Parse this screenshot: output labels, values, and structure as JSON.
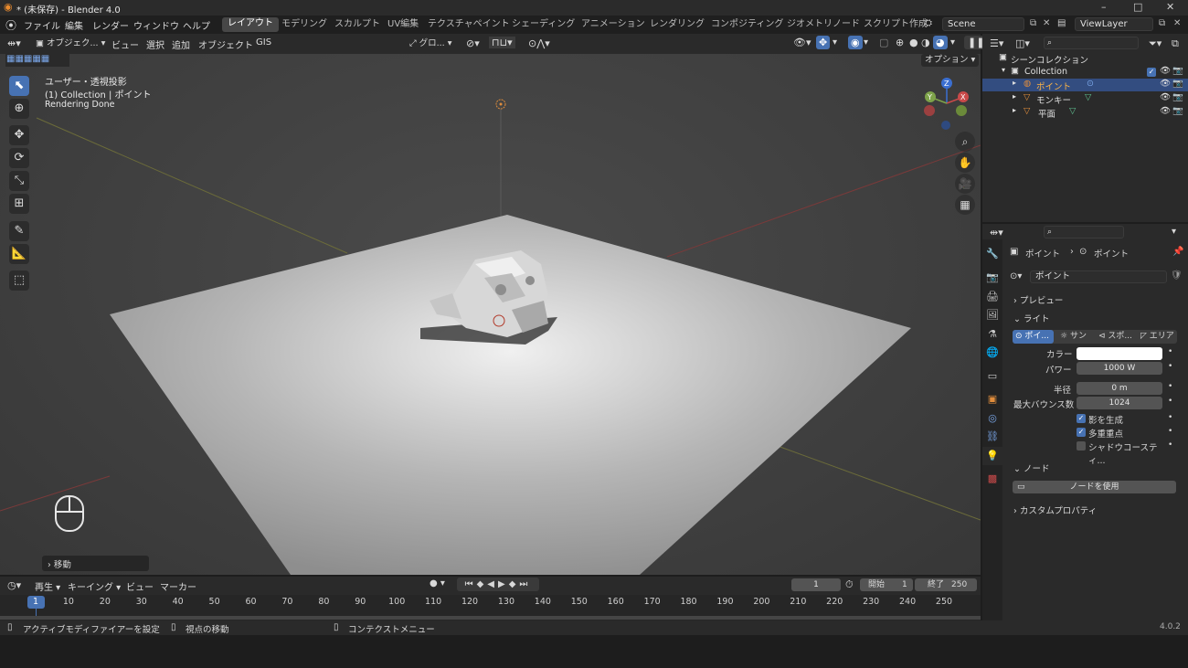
{
  "window": {
    "title": "* (未保存) - Blender 4.0",
    "minimize": "–",
    "maximize": "□",
    "close": "✕"
  },
  "menu": [
    "ファイル",
    "編集",
    "レンダー",
    "ウィンドウ",
    "ヘルプ"
  ],
  "workspaces": [
    "レイアウト",
    "モデリング",
    "スカルプト",
    "UV編集",
    "テクスチャペイント",
    "シェーディング",
    "アニメーション",
    "レンダリング",
    "コンポジティング",
    "ジオメトリノード",
    "スクリプト作成"
  ],
  "scene": {
    "name": "Scene",
    "view_layer": "ViewLayer"
  },
  "viewport_header": {
    "mode": "オブジェク...",
    "menus": [
      "ビュー",
      "選択",
      "追加",
      "オブジェクト",
      "GIS"
    ],
    "transform": "グロ...",
    "options": "オプション"
  },
  "viewport_info": {
    "line1": "ユーザー・透視投影",
    "line2": "(1) Collection | ポイント",
    "line3": "Rendering Done"
  },
  "gizmo": {
    "x": "X",
    "y": "Y",
    "z": "Z"
  },
  "operator_panel": "移動",
  "outliner": {
    "root": "シーンコレクション",
    "collection": "Collection",
    "items": [
      "ポイント",
      "モンキー",
      "平面"
    ]
  },
  "properties": {
    "breadcrumb1": "ポイント",
    "breadcrumb2": "ポイント",
    "data_name": "ポイント",
    "preview": "プレビュー",
    "light_section": "ライト",
    "light_types": [
      "ポイ...",
      "サン",
      "スポ...",
      "エリア"
    ],
    "color_label": "カラー",
    "power_label": "パワー",
    "power_value": "1000 W",
    "radius_label": "半径",
    "radius_value": "0 m",
    "bounces_label": "最大バウンス数",
    "bounces_value": "1024",
    "cast_shadow": "影を生成",
    "multi_importance": "多重重点",
    "shadow_caustics": "シャドウコースティ...",
    "nodes_section": "ノード",
    "use_nodes": "ノードを使用",
    "custom_props": "カスタムプロパティ"
  },
  "timeline": {
    "menus": [
      "再生",
      "キーイング",
      "ビュー",
      "マーカー"
    ],
    "current_frame": "1",
    "start_label": "開始",
    "start": "1",
    "end_label": "終了",
    "end": "250",
    "ticks": [
      "1",
      "10",
      "20",
      "30",
      "40",
      "50",
      "60",
      "70",
      "80",
      "90",
      "100",
      "110",
      "120",
      "130",
      "140",
      "150",
      "160",
      "170",
      "180",
      "190",
      "200",
      "210",
      "220",
      "230",
      "240",
      "250"
    ]
  },
  "statusbar": {
    "hint1": "アクティブモディファイアーを設定",
    "hint2": "視点の移動",
    "hint3": "コンテクストメニュー",
    "version": "4.0.2"
  }
}
